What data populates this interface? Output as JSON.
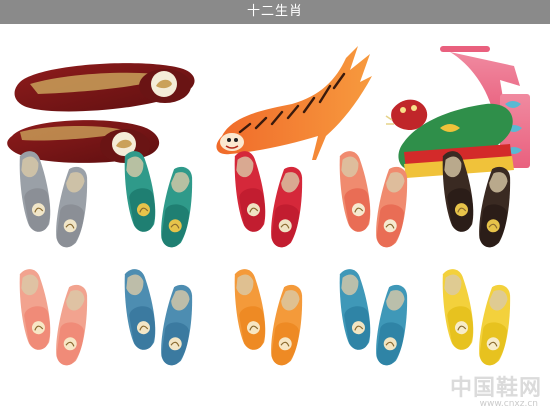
{
  "title": "十二生肖",
  "watermark": {
    "name": "中国鞋网",
    "url": "www.cnxz.cn"
  },
  "colors": {
    "title_bar_bg": "#8a8a8a",
    "title_text": "#ffffff"
  },
  "zodiac_pairs": [
    {
      "sole": "#9aa0a7",
      "upper": "#8b8f96",
      "motif": "#f1e6c8"
    },
    {
      "sole": "#2f9a8a",
      "upper": "#1f7f72",
      "motif": "#e7c34a"
    },
    {
      "sole": "#d5283a",
      "upper": "#c21d30",
      "motif": "#efe3c4"
    },
    {
      "sole": "#f08b6f",
      "upper": "#e96d55",
      "motif": "#f6ead0"
    },
    {
      "sole": "#3a2a22",
      "upper": "#2b1d18",
      "motif": "#e7c34a"
    },
    {
      "sole": "#f2a38f",
      "upper": "#f08b78",
      "motif": "#f7e7c6"
    },
    {
      "sole": "#4d8db1",
      "upper": "#3b7aa0",
      "motif": "#f3e6c6"
    },
    {
      "sole": "#f49a3a",
      "upper": "#ee8a24",
      "motif": "#f7e6c3"
    },
    {
      "sole": "#3f98b8",
      "upper": "#2f84a6",
      "motif": "#f2e5c2"
    },
    {
      "sole": "#f3d13c",
      "upper": "#e7c21f",
      "motif": "#f7ecc9"
    }
  ]
}
